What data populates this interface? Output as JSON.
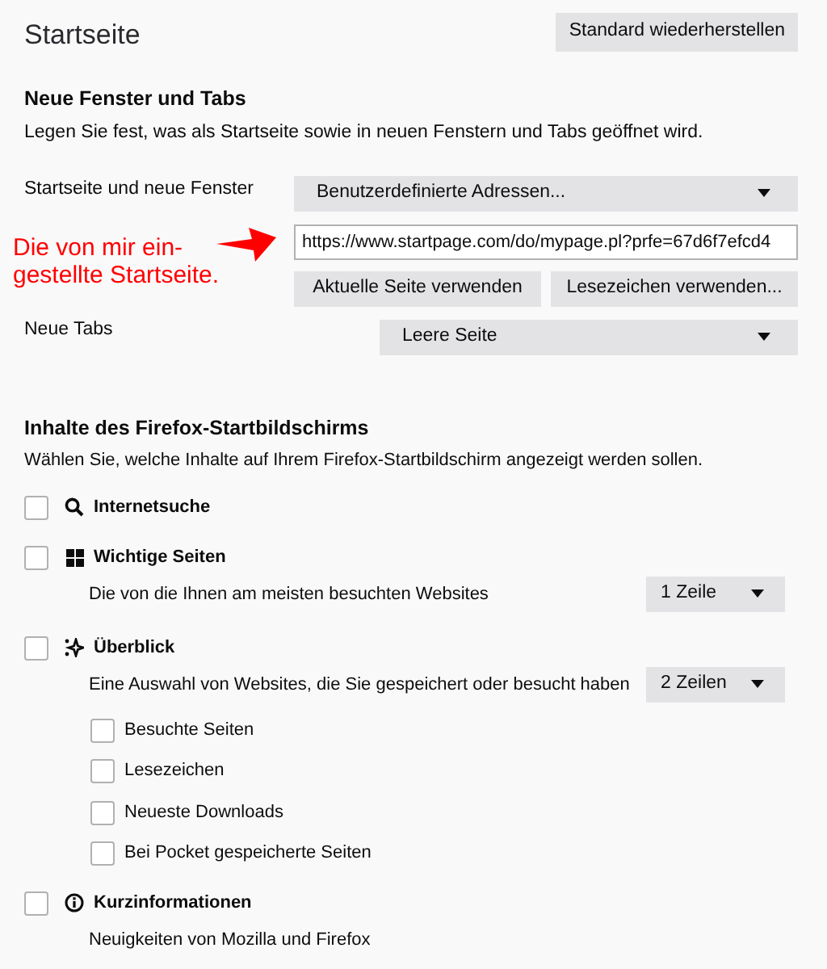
{
  "page_title": "Startseite",
  "restore_button": {
    "label": "Standard wiederherstellen"
  },
  "new_windows": {
    "heading": "Neue Fenster und Tabs",
    "description": "Legen Sie fest, was als Startseite sowie in neuen Fenstern und Tabs geöffnet wird.",
    "home_label": "Startseite und neue Fenster",
    "home_dropdown": "Benutzerdefinierte Adressen...",
    "url_value": "https://www.startpage.com/do/mypage.pl?prfe=67d6f7efcd4",
    "buttons": [
      {
        "label": "Aktuelle Seite verwenden"
      },
      {
        "label": "Lesezeichen verwenden..."
      }
    ],
    "tabs_label": "Neue Tabs",
    "tabs_dropdown": "Leere Seite"
  },
  "annotation": {
    "lines": [
      "Die von mir ein-",
      "gestellte Startseite."
    ]
  },
  "home_content": {
    "heading": "Inhalte des Firefox-Startbildschirms",
    "description": "Wählen Sie, welche Inhalte auf Ihrem Firefox-Startbildschirm angezeigt werden sollen.",
    "items": [
      {
        "label": "Internetsuche",
        "checked": false
      },
      {
        "label": "Wichtige Seiten",
        "checked": false,
        "description": "Die von die Ihnen am meisten besuchten Websites",
        "rows": "1 Zeile"
      },
      {
        "label": "Überblick",
        "checked": false,
        "description": "Eine Auswahl von Websites, die Sie gespeichert oder besucht haben",
        "rows": "2 Zeilen",
        "children": [
          {
            "label": "Besuchte Seiten",
            "checked": false
          },
          {
            "label": "Lesezeichen",
            "checked": false
          },
          {
            "label": "Neueste Downloads",
            "checked": false
          },
          {
            "label": "Bei Pocket gespeicherte Seiten",
            "checked": false
          }
        ]
      },
      {
        "label": "Kurzinformationen",
        "checked": false,
        "description": "Neuigkeiten von Mozilla und Firefox"
      }
    ]
  }
}
